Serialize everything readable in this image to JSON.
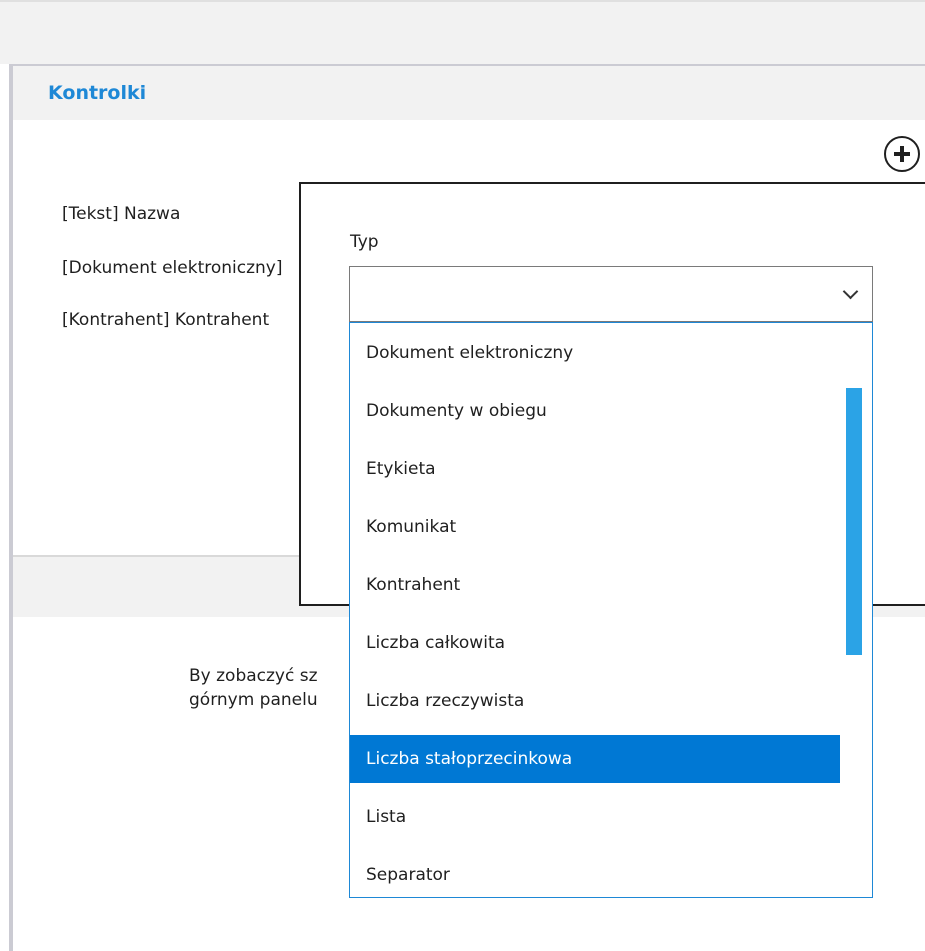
{
  "panel": {
    "title": "Kontrolki",
    "controls": [
      "[Tekst] Nazwa",
      "[Dokument elektroniczny]",
      "[Kontrahent] Kontrahent"
    ],
    "hint_line1": "By zobaczyć sz",
    "hint_line2": "górnym panelu"
  },
  "dialog": {
    "field_label": "Typ",
    "selected_value": "",
    "options": [
      "Dokument elektroniczny",
      "Dokumenty w obiegu",
      "Etykieta",
      "Komunikat",
      "Kontrahent",
      "Liczba całkowita",
      "Liczba rzeczywista",
      "Liczba stałoprzecinkowa",
      "Lista",
      "Separator"
    ],
    "highlighted_option": "Liczba stałoprzecinkowa"
  },
  "colors": {
    "accent": "#1e88d6",
    "selection": "#0078d4",
    "scrollbar": "#2ba3e6"
  },
  "icons": {
    "add": "plus-circle-icon",
    "dropdown": "chevron-down-icon"
  }
}
